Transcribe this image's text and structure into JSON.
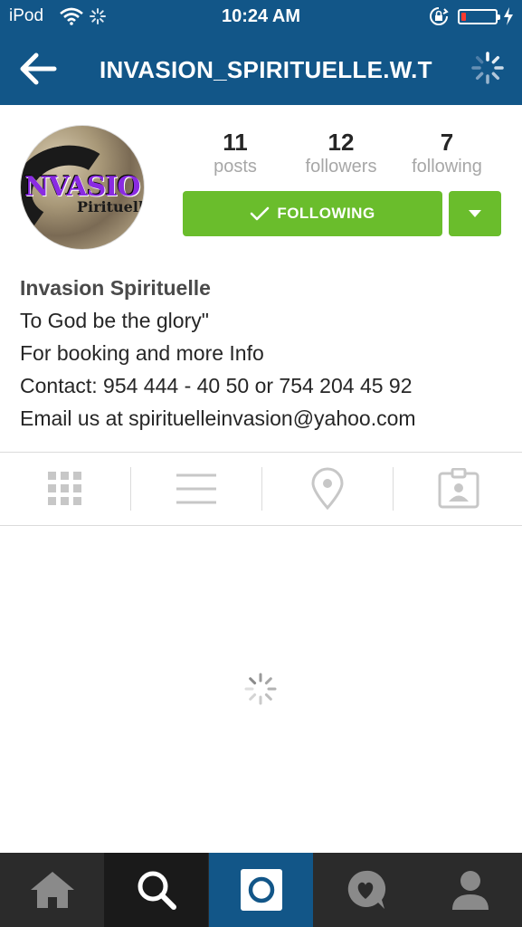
{
  "status_bar": {
    "carrier": "iPod",
    "time": "10:24 AM",
    "battery_level": 0.15,
    "battery_color": "#ff3b30"
  },
  "nav": {
    "title": "INVASION_SPIRITUELLE.W.T",
    "back_icon": "back-arrow-icon",
    "spinner_icon": "loading-spinner-icon"
  },
  "profile": {
    "avatar_text_top": "NVASIO",
    "avatar_text_bottom": "Pirituelle",
    "stats": [
      {
        "value": "11",
        "label": "posts"
      },
      {
        "value": "12",
        "label": "followers"
      },
      {
        "value": "7",
        "label": "following"
      }
    ],
    "follow_button_label": "FOLLOWING",
    "bio": {
      "name": "Invasion Spirituelle",
      "lines": [
        "To God be the glory\"",
        "For booking and more Info",
        "Contact: 954 444 - 40 50 or 754 204 45 92",
        "Email us at spirituelleinvasion@yahoo.com"
      ]
    }
  },
  "view_tabs": [
    "grid-icon",
    "list-icon",
    "location-pin-icon",
    "tagged-icon"
  ],
  "bottom_tabs": [
    "home-icon",
    "search-icon",
    "camera-icon",
    "activity-icon",
    "profile-icon"
  ],
  "colors": {
    "header_blue": "#125688",
    "follow_green": "#6abd2c",
    "tabbar_dark": "#2b2b2b"
  }
}
